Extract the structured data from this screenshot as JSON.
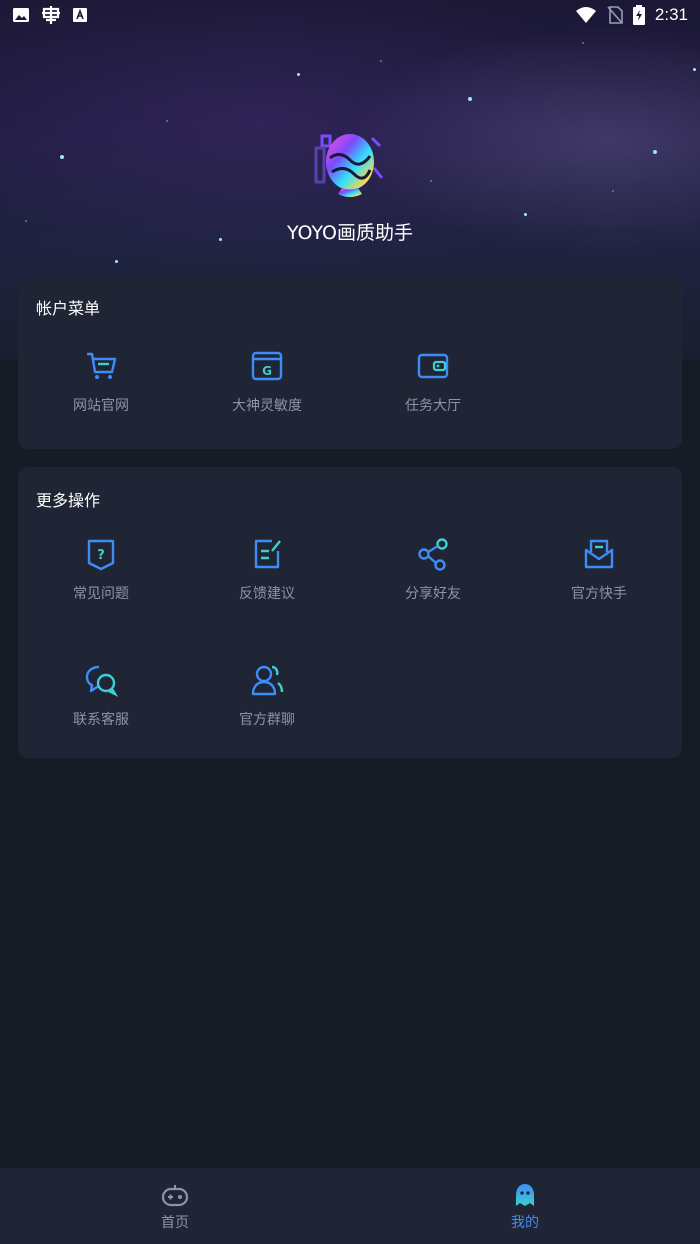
{
  "statusbar": {
    "time": "2:31",
    "left_icons": [
      "image-icon",
      "bug-icon",
      "font-a-icon"
    ],
    "right_icons": [
      "wifi-icon",
      "no-sim-icon",
      "battery-charging-icon"
    ]
  },
  "header": {
    "app_name": "YOYO画质助手",
    "logo": "app-logo"
  },
  "account_menu": {
    "title": "帐户菜单",
    "items": [
      {
        "label": "网站官网",
        "icon": "cart-icon"
      },
      {
        "label": "大神灵敏度",
        "icon": "g-window-icon"
      },
      {
        "label": "任务大厅",
        "icon": "wallet-icon"
      }
    ]
  },
  "more_actions": {
    "title": "更多操作",
    "items": [
      {
        "label": "常见问题",
        "icon": "question-shield-icon"
      },
      {
        "label": "反馈建议",
        "icon": "edit-note-icon"
      },
      {
        "label": "分享好友",
        "icon": "share-icon"
      },
      {
        "label": "官方快手",
        "icon": "mail-open-icon"
      },
      {
        "label": "联系客服",
        "icon": "chat-bubbles-icon"
      },
      {
        "label": "官方群聊",
        "icon": "group-icon"
      }
    ]
  },
  "bottom_nav": {
    "items": [
      {
        "label": "首页",
        "icon": "gamepad-icon",
        "active": false
      },
      {
        "label": "我的",
        "icon": "ghost-avatar-icon",
        "active": true
      }
    ]
  },
  "colors": {
    "accent_blue": "#3e8df5",
    "accent_teal": "#3ecfd0",
    "card_bg": "#1f2534",
    "page_bg": "#161b25",
    "label_gray": "#8c94a6"
  }
}
